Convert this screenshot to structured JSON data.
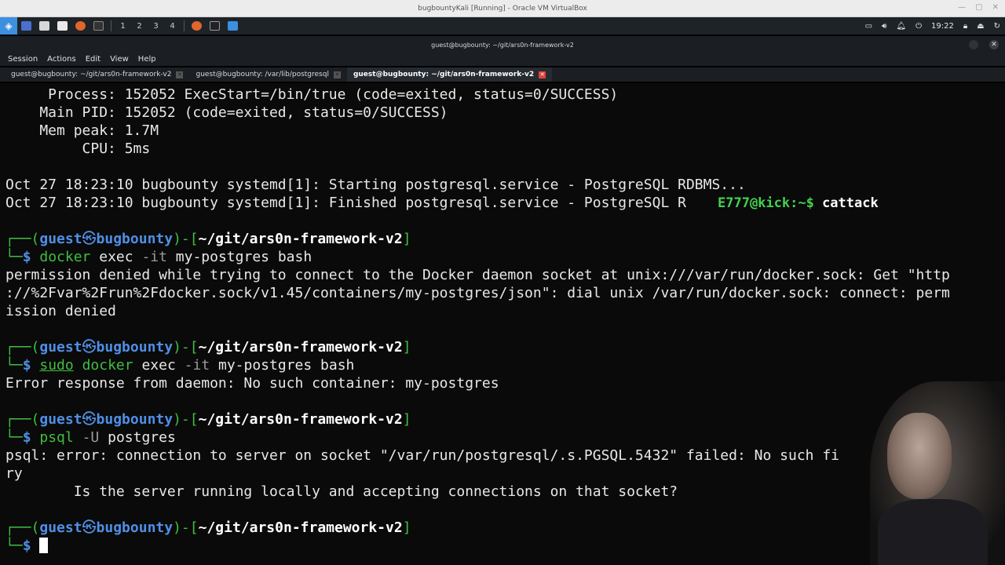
{
  "vbox": {
    "title": "bugbountyKali [Running] - Oracle VM VirtualBox"
  },
  "panel": {
    "workspaces": [
      "1",
      "2",
      "3",
      "4"
    ],
    "clock": "19:22"
  },
  "terminal": {
    "title": "guest@bugbounty: ~/git/ars0n-framework-v2",
    "menu": [
      "Session",
      "Actions",
      "Edit",
      "View",
      "Help"
    ],
    "tabs": [
      "guest@bugbounty: ~/git/ars0n-framework-v2",
      "guest@bugbounty: /var/lib/postgresql",
      "guest@bugbounty: ~/git/ars0n-framework-v2"
    ],
    "lines": {
      "l1": "     Process: 152052 ExecStart=/bin/true (code=exited, status=0/SUCCESS)",
      "l2": "    Main PID: 152052 (code=exited, status=0/SUCCESS)",
      "l3": "    Mem peak: 1.7M",
      "l4": "         CPU: 5ms",
      "l5": "Oct 27 18:23:10 bugbounty systemd[1]: Starting postgresql.service - PostgreSQL RDBMS...",
      "l6": "Oct 27 18:23:10 bugbounty systemd[1]: Finished postgresql.service - PostgreSQL R",
      "prompt_user": "guest",
      "prompt_host": "bugbounty",
      "prompt_path": "~/git/ars0n-framework-v2",
      "cmd1_a": "docker",
      "cmd1_b": " exec ",
      "cmd1_c": "-it",
      "cmd1_d": " my-postgres bash",
      "out1_1": "permission denied while trying to connect to the Docker daemon socket at unix:///var/run/docker.sock: Get \"http",
      "out1_2": "://%2Fvar%2Frun%2Fdocker.sock/v1.45/containers/my-postgres/json\": dial unix /var/run/docker.sock: connect: perm",
      "out1_3": "ission denied",
      "cmd2_a": "sudo",
      "cmd2_b": "docker",
      "cmd2_c": " exec ",
      "cmd2_d": "-it",
      "cmd2_e": " my-postgres bash",
      "out2_1": "Error response from daemon: No such container: my-postgres",
      "cmd3_a": "psql",
      "cmd3_b": "-U",
      "cmd3_c": " postgres",
      "out3_1": "psql: error: connection to server on socket \"/var/run/postgresql/.s.PGSQL.5432\" failed: No such fi",
      "out3_2": "ry",
      "out3_3": "        Is the server running locally and accepting connections on that socket?"
    }
  },
  "overlay": {
    "user": "E777@kick:~$",
    "cmd": " cattack"
  }
}
